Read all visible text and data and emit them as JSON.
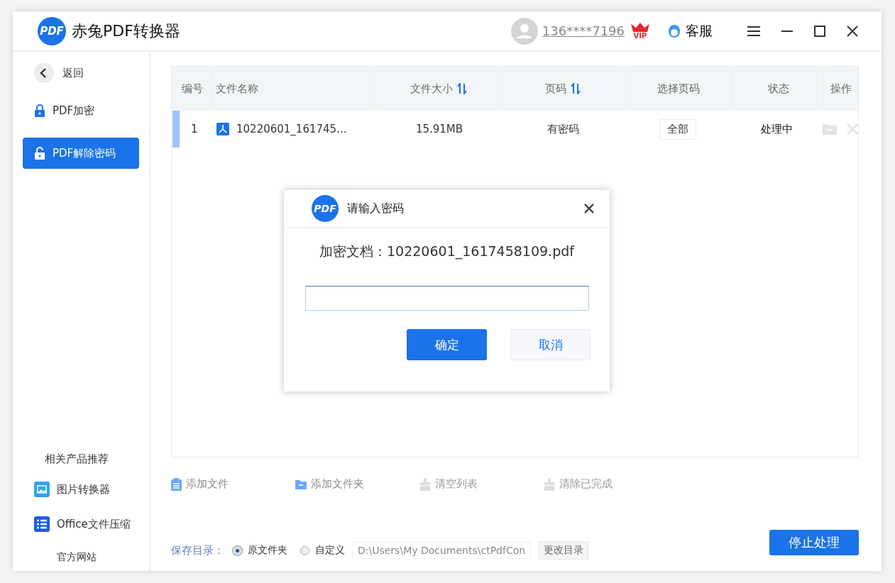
{
  "app": {
    "logo_text": "PDF",
    "title": "赤兔PDF转换器"
  },
  "header": {
    "user": "136****7196",
    "vip": "VIP",
    "service": "客服"
  },
  "sidebar": {
    "back": "返回",
    "items": [
      {
        "label": "PDF加密",
        "kind": "lock",
        "selected": false
      },
      {
        "label": "PDF解除密码",
        "kind": "unlock",
        "selected": true
      }
    ],
    "related_title": "相关产品推荐",
    "products": [
      {
        "label": "图片转换器",
        "kind": "image"
      },
      {
        "label": "Office文件压缩",
        "kind": "list"
      }
    ],
    "website": "官方网站"
  },
  "table": {
    "columns": [
      {
        "label": "编号",
        "sortable": false
      },
      {
        "label": "文件名称",
        "sortable": false
      },
      {
        "label": "文件大小",
        "sortable": true
      },
      {
        "label": "页码",
        "sortable": true
      },
      {
        "label": "选择页码",
        "sortable": false
      },
      {
        "label": "状态",
        "sortable": false
      },
      {
        "label": "操作",
        "sortable": false
      }
    ],
    "rows": [
      {
        "no": "1",
        "name": "10220601_161745...",
        "size": "15.91MB",
        "pages": "有密码",
        "page_select": "全部",
        "status": "处理中",
        "selected": true
      }
    ]
  },
  "toolbar": [
    {
      "label": "添加文件",
      "kind": "file",
      "disabled": false
    },
    {
      "label": "添加文件夹",
      "kind": "folder",
      "disabled": false
    },
    {
      "label": "清空列表",
      "kind": "brush",
      "disabled": true
    },
    {
      "label": "清除已完成",
      "kind": "brush",
      "disabled": true
    }
  ],
  "save": {
    "label": "保存目录：",
    "options": [
      {
        "label": "原文件夹",
        "selected": true
      },
      {
        "label": "自定义",
        "selected": false
      }
    ],
    "path": "D:\\Users\\My Documents\\ctPdfCon",
    "change_button": "更改目录"
  },
  "stop_button": "停止处理",
  "dialog": {
    "logo_text": "PDF",
    "title": "请输入密码",
    "message": "加密文档：10220601_1617458109.pdf",
    "confirm": "确定",
    "cancel": "取消"
  }
}
